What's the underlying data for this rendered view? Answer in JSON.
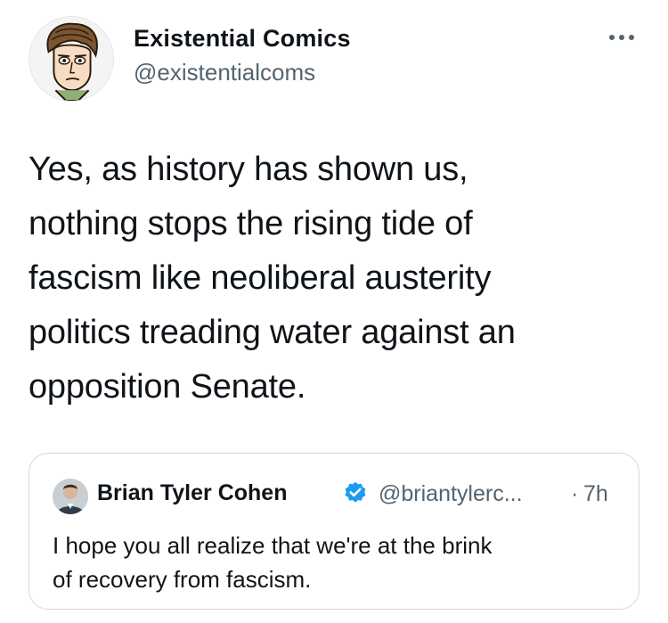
{
  "tweet": {
    "author": {
      "display_name": "Existential Comics",
      "handle": "@existentialcoms",
      "avatar_icon": "cartoon-portrait-avatar"
    },
    "more_icon": "more-horizontal-icon",
    "text": "Yes, as history has shown us,\nnothing stops the rising tide of\nfascism like neoliberal austerity\npolitics treading water against an\nopposition Senate."
  },
  "quote": {
    "author": {
      "display_name": "Brian Tyler Cohen",
      "handle": "@briantylerc...",
      "verified_icon": "verified-badge-icon",
      "verified_color": "#1d9bf0",
      "avatar_icon": "profile-photo-avatar"
    },
    "separator": "·",
    "time": "7h",
    "text": "I hope you all realize that we're at the brink\nof recovery from fascism."
  }
}
